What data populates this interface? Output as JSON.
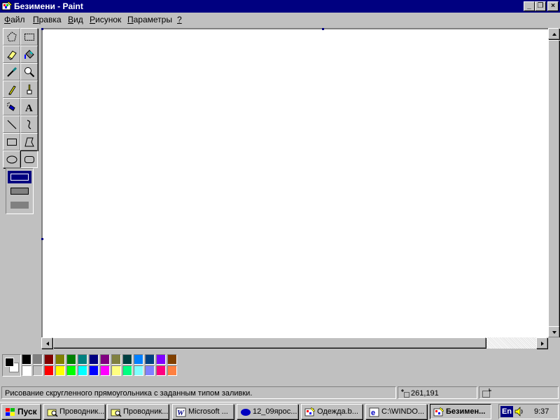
{
  "window": {
    "title": "Безимени - Paint",
    "min_label": "_",
    "restore_label": "❐",
    "close_label": "×"
  },
  "menu": {
    "file": {
      "first": "Ф",
      "rest": "айл"
    },
    "edit": {
      "first": "П",
      "rest": "равка"
    },
    "view": {
      "first": "В",
      "rest": "ид"
    },
    "image": {
      "first": "Р",
      "rest": "исунок"
    },
    "options": {
      "first": "П",
      "rest": "араметры"
    },
    "help": {
      "first": "?",
      "rest": ""
    }
  },
  "tools": [
    {
      "name": "free-select-icon",
      "active": false
    },
    {
      "name": "rect-select-icon",
      "active": false
    },
    {
      "name": "eraser-icon",
      "active": false
    },
    {
      "name": "fill-bucket-icon",
      "active": false
    },
    {
      "name": "color-picker-icon",
      "active": false
    },
    {
      "name": "magnifier-icon",
      "active": false
    },
    {
      "name": "pencil-icon",
      "active": false
    },
    {
      "name": "brush-icon",
      "active": false
    },
    {
      "name": "airbrush-icon",
      "active": false
    },
    {
      "name": "text-icon",
      "active": false
    },
    {
      "name": "line-icon",
      "active": false
    },
    {
      "name": "curve-icon",
      "active": false
    },
    {
      "name": "rectangle-icon",
      "active": false
    },
    {
      "name": "polygon-icon",
      "active": false
    },
    {
      "name": "ellipse-icon",
      "active": false
    },
    {
      "name": "rounded-rect-icon",
      "active": true
    }
  ],
  "text_tool_glyph": "A",
  "fill_styles": [
    "outline",
    "outline-fill",
    "fill"
  ],
  "selected_fill_style": 0,
  "colors": {
    "foreground": "#000000",
    "background": "#ffffff",
    "titlebar": "#000080",
    "palette_top": [
      "#000000",
      "#808080",
      "#800000",
      "#808000",
      "#008000",
      "#008080",
      "#000080",
      "#800080",
      "#808040",
      "#004040",
      "#0080ff",
      "#004080",
      "#8000ff",
      "#804000"
    ],
    "palette_bottom": [
      "#ffffff",
      "#c0c0c0",
      "#ff0000",
      "#ffff00",
      "#00ff00",
      "#00ffff",
      "#0000ff",
      "#ff00ff",
      "#ffff80",
      "#00ff80",
      "#80ffff",
      "#8080ff",
      "#ff0080",
      "#ff8040"
    ]
  },
  "status": {
    "hint": "Рисование скругленного прямоугольника с заданным типом заливки.",
    "coords": "261,191",
    "size": ""
  },
  "taskbar": {
    "start": "Пуск",
    "tasks": [
      {
        "label": "Проводник...",
        "icon": "explorer-icon",
        "active": false
      },
      {
        "label": "Проводник...",
        "icon": "explorer-icon",
        "active": false
      },
      {
        "label": "Microsoft ...",
        "icon": "word-icon",
        "active": false
      },
      {
        "label": "12_09ярос...",
        "icon": "ellipse-doc-icon",
        "active": false
      },
      {
        "label": "Одежда.b...",
        "icon": "paint-icon",
        "active": false
      },
      {
        "label": "C:\\WINDO...",
        "icon": "ie-icon",
        "active": false
      },
      {
        "label": "Безимен...",
        "icon": "paint-icon",
        "active": true
      }
    ],
    "lang": "En",
    "clock": "9:37"
  }
}
